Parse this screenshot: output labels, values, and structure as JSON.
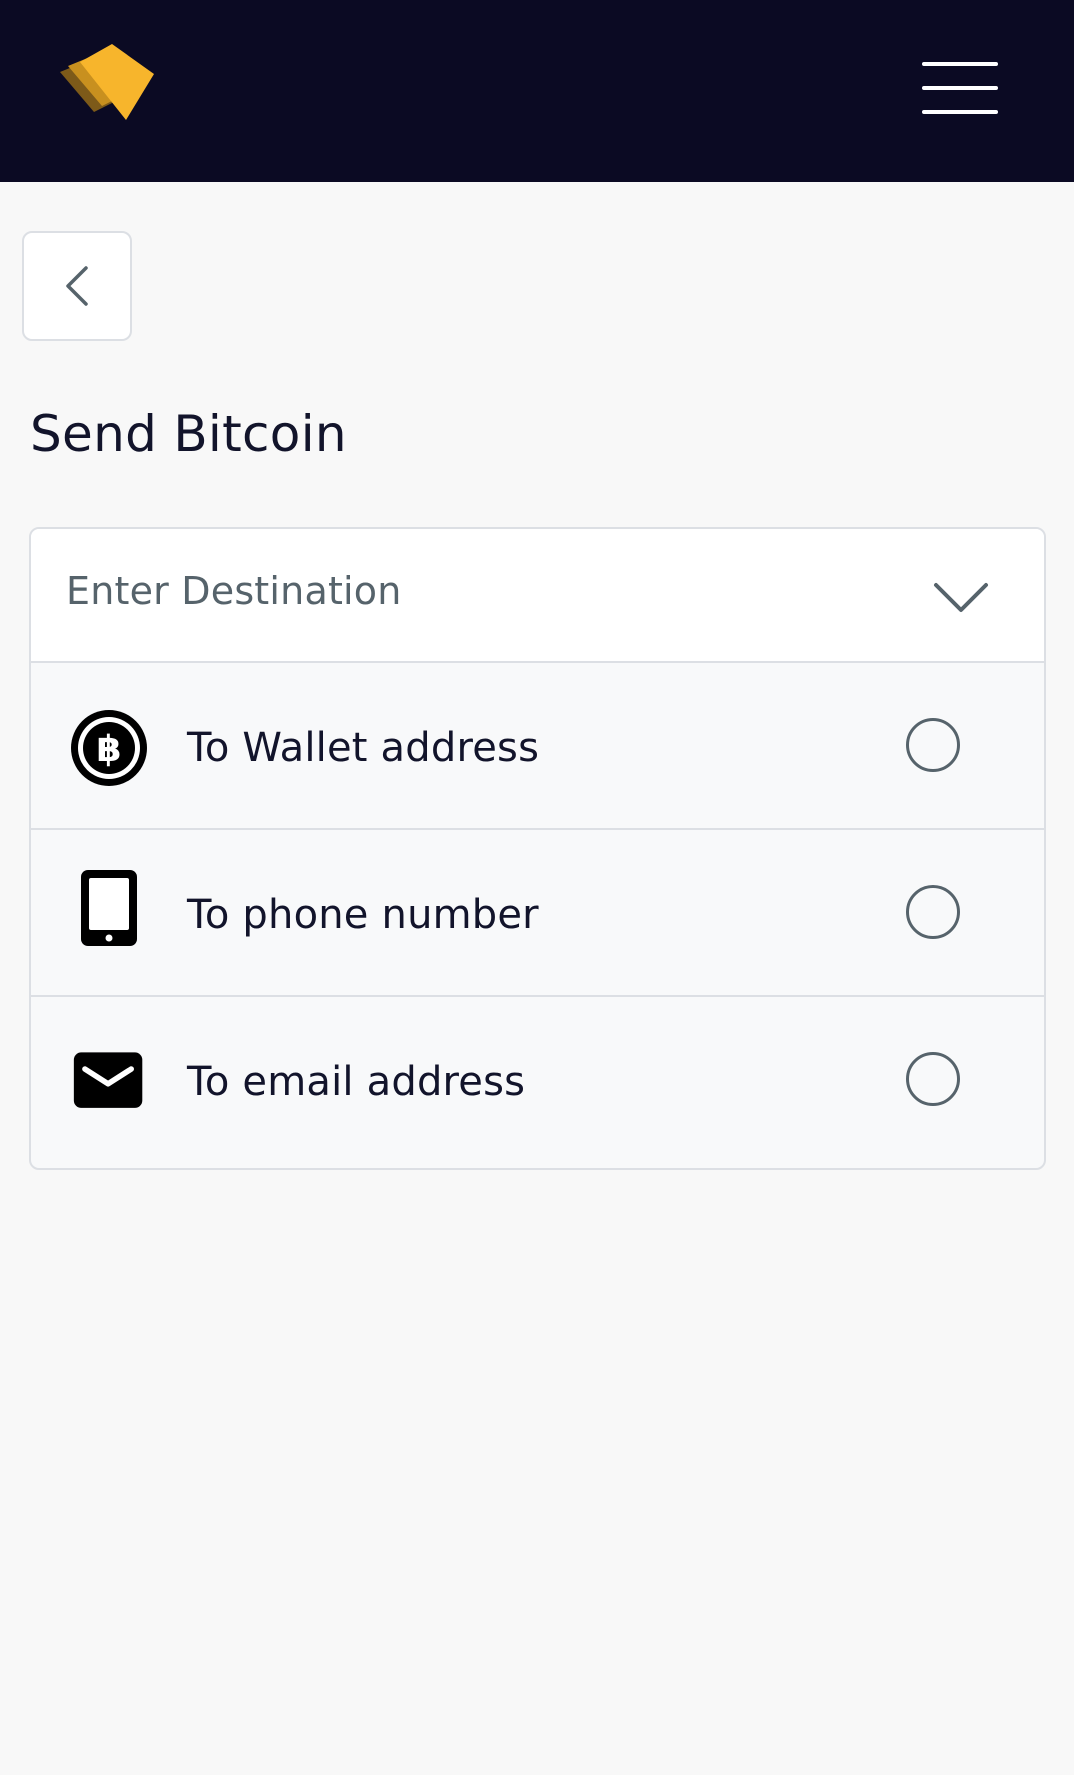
{
  "header": {
    "logo_icon": "wallet-cards-logo",
    "menu_icon": "hamburger-menu-icon",
    "background_color": "#0b0a23",
    "accent_color": "#f7b52c"
  },
  "back_button": {
    "icon": "chevron-left-icon"
  },
  "page": {
    "title": "Send Bitcoin"
  },
  "destination_select": {
    "placeholder": "Enter Destination",
    "icon": "chevron-down-icon",
    "options": [
      {
        "label": "To Wallet address",
        "icon": "bitcoin-coin-icon",
        "selected": false
      },
      {
        "label": "To phone number",
        "icon": "phone-icon",
        "selected": false
      },
      {
        "label": "To email address",
        "icon": "envelope-icon",
        "selected": false
      }
    ]
  }
}
